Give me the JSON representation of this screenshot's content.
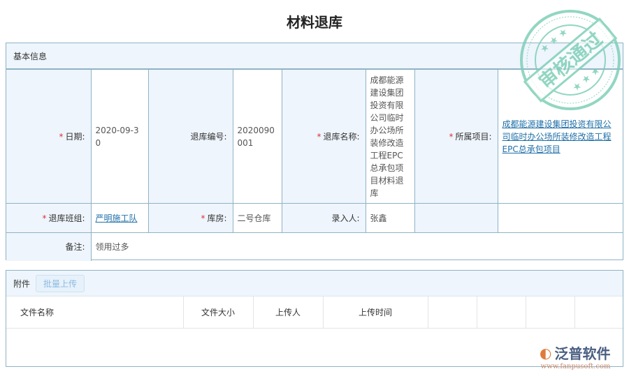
{
  "title": "材料退库",
  "basic": {
    "section_title": "基本信息",
    "date_label": "日期:",
    "date_value": "2020-09-30",
    "code_label": "退库编号:",
    "code_value": "2020090001",
    "name_label": "退库名称:",
    "name_value": "成都能源建设集团投资有限公司临时办公场所装修改造工程EPC总承包项目材料退库",
    "project_label": "所属项目:",
    "project_value": "成都能源建设集团投资有限公司临时办公场所装修改造工程EPC总承包项目",
    "team_label": "退库班组:",
    "team_value": "严明施工队",
    "warehouse_label": "库房:",
    "warehouse_value": "二号仓库",
    "entry_label": "录入人:",
    "entry_value": "张鑫",
    "remark_label": "备注:",
    "remark_value": "领用过多",
    "required_mark": "*"
  },
  "attachments": {
    "section_title": "附件",
    "upload_button": "批量上传",
    "columns": [
      "文件名称",
      "文件大小",
      "上传人",
      "上传时间",
      "",
      "",
      "",
      ""
    ]
  },
  "stamp": {
    "text": "审核通过",
    "color": "#7fcfb8"
  },
  "logo": {
    "name": "泛普软件",
    "url": "www.fanpusoft.com"
  }
}
